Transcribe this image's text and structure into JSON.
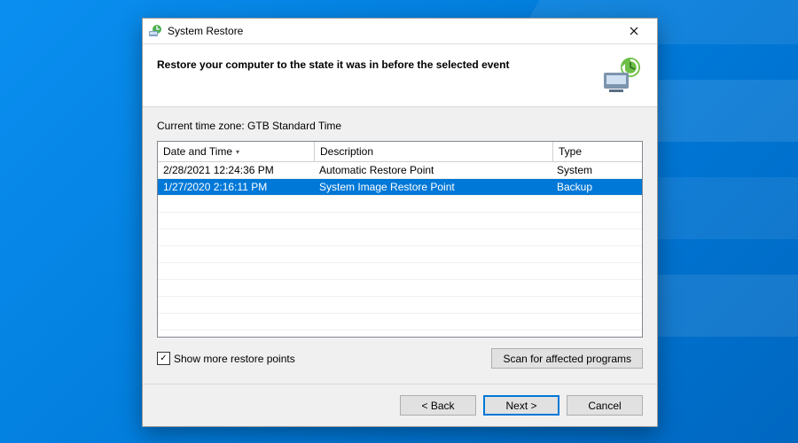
{
  "window": {
    "title": "System Restore"
  },
  "header": {
    "heading": "Restore your computer to the state it was in before the selected event"
  },
  "timezone_label": "Current time zone: GTB Standard Time",
  "columns": {
    "date": "Date and Time",
    "desc": "Description",
    "type": "Type"
  },
  "rows": [
    {
      "date": "2/28/2021 12:24:36 PM",
      "desc": "Automatic Restore Point",
      "type": "System",
      "selected": false
    },
    {
      "date": "1/27/2020 2:16:11 PM",
      "desc": "System Image Restore Point",
      "type": "Backup",
      "selected": true
    }
  ],
  "show_more": {
    "label": "Show more restore points",
    "checked": true
  },
  "buttons": {
    "scan": "Scan for affected programs",
    "back": "< Back",
    "next": "Next >",
    "cancel": "Cancel"
  }
}
